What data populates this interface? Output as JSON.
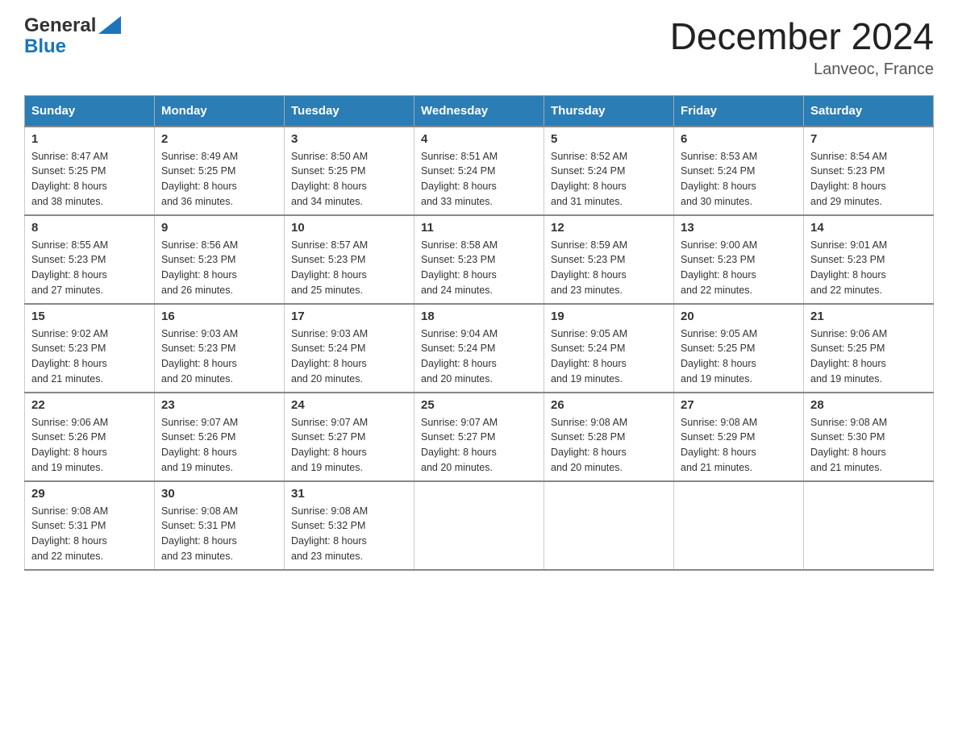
{
  "header": {
    "logo_line1": "General",
    "logo_line2": "Blue",
    "title": "December 2024",
    "location": "Lanveoc, France"
  },
  "days_of_week": [
    "Sunday",
    "Monday",
    "Tuesday",
    "Wednesday",
    "Thursday",
    "Friday",
    "Saturday"
  ],
  "weeks": [
    [
      {
        "day": "1",
        "sunrise": "8:47 AM",
        "sunset": "5:25 PM",
        "daylight": "8 hours and 38 minutes."
      },
      {
        "day": "2",
        "sunrise": "8:49 AM",
        "sunset": "5:25 PM",
        "daylight": "8 hours and 36 minutes."
      },
      {
        "day": "3",
        "sunrise": "8:50 AM",
        "sunset": "5:25 PM",
        "daylight": "8 hours and 34 minutes."
      },
      {
        "day": "4",
        "sunrise": "8:51 AM",
        "sunset": "5:24 PM",
        "daylight": "8 hours and 33 minutes."
      },
      {
        "day": "5",
        "sunrise": "8:52 AM",
        "sunset": "5:24 PM",
        "daylight": "8 hours and 31 minutes."
      },
      {
        "day": "6",
        "sunrise": "8:53 AM",
        "sunset": "5:24 PM",
        "daylight": "8 hours and 30 minutes."
      },
      {
        "day": "7",
        "sunrise": "8:54 AM",
        "sunset": "5:23 PM",
        "daylight": "8 hours and 29 minutes."
      }
    ],
    [
      {
        "day": "8",
        "sunrise": "8:55 AM",
        "sunset": "5:23 PM",
        "daylight": "8 hours and 27 minutes."
      },
      {
        "day": "9",
        "sunrise": "8:56 AM",
        "sunset": "5:23 PM",
        "daylight": "8 hours and 26 minutes."
      },
      {
        "day": "10",
        "sunrise": "8:57 AM",
        "sunset": "5:23 PM",
        "daylight": "8 hours and 25 minutes."
      },
      {
        "day": "11",
        "sunrise": "8:58 AM",
        "sunset": "5:23 PM",
        "daylight": "8 hours and 24 minutes."
      },
      {
        "day": "12",
        "sunrise": "8:59 AM",
        "sunset": "5:23 PM",
        "daylight": "8 hours and 23 minutes."
      },
      {
        "day": "13",
        "sunrise": "9:00 AM",
        "sunset": "5:23 PM",
        "daylight": "8 hours and 22 minutes."
      },
      {
        "day": "14",
        "sunrise": "9:01 AM",
        "sunset": "5:23 PM",
        "daylight": "8 hours and 22 minutes."
      }
    ],
    [
      {
        "day": "15",
        "sunrise": "9:02 AM",
        "sunset": "5:23 PM",
        "daylight": "8 hours and 21 minutes."
      },
      {
        "day": "16",
        "sunrise": "9:03 AM",
        "sunset": "5:23 PM",
        "daylight": "8 hours and 20 minutes."
      },
      {
        "day": "17",
        "sunrise": "9:03 AM",
        "sunset": "5:24 PM",
        "daylight": "8 hours and 20 minutes."
      },
      {
        "day": "18",
        "sunrise": "9:04 AM",
        "sunset": "5:24 PM",
        "daylight": "8 hours and 20 minutes."
      },
      {
        "day": "19",
        "sunrise": "9:05 AM",
        "sunset": "5:24 PM",
        "daylight": "8 hours and 19 minutes."
      },
      {
        "day": "20",
        "sunrise": "9:05 AM",
        "sunset": "5:25 PM",
        "daylight": "8 hours and 19 minutes."
      },
      {
        "day": "21",
        "sunrise": "9:06 AM",
        "sunset": "5:25 PM",
        "daylight": "8 hours and 19 minutes."
      }
    ],
    [
      {
        "day": "22",
        "sunrise": "9:06 AM",
        "sunset": "5:26 PM",
        "daylight": "8 hours and 19 minutes."
      },
      {
        "day": "23",
        "sunrise": "9:07 AM",
        "sunset": "5:26 PM",
        "daylight": "8 hours and 19 minutes."
      },
      {
        "day": "24",
        "sunrise": "9:07 AM",
        "sunset": "5:27 PM",
        "daylight": "8 hours and 19 minutes."
      },
      {
        "day": "25",
        "sunrise": "9:07 AM",
        "sunset": "5:27 PM",
        "daylight": "8 hours and 20 minutes."
      },
      {
        "day": "26",
        "sunrise": "9:08 AM",
        "sunset": "5:28 PM",
        "daylight": "8 hours and 20 minutes."
      },
      {
        "day": "27",
        "sunrise": "9:08 AM",
        "sunset": "5:29 PM",
        "daylight": "8 hours and 21 minutes."
      },
      {
        "day": "28",
        "sunrise": "9:08 AM",
        "sunset": "5:30 PM",
        "daylight": "8 hours and 21 minutes."
      }
    ],
    [
      {
        "day": "29",
        "sunrise": "9:08 AM",
        "sunset": "5:31 PM",
        "daylight": "8 hours and 22 minutes."
      },
      {
        "day": "30",
        "sunrise": "9:08 AM",
        "sunset": "5:31 PM",
        "daylight": "8 hours and 23 minutes."
      },
      {
        "day": "31",
        "sunrise": "9:08 AM",
        "sunset": "5:32 PM",
        "daylight": "8 hours and 23 minutes."
      },
      null,
      null,
      null,
      null
    ]
  ],
  "labels": {
    "sunrise": "Sunrise:",
    "sunset": "Sunset:",
    "daylight": "Daylight:"
  }
}
